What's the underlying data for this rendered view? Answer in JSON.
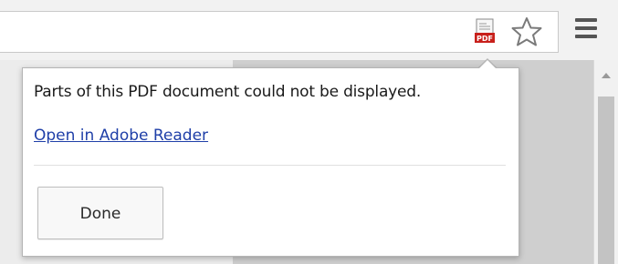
{
  "toolbar": {
    "pdf_badge": "PDF",
    "icons": [
      "pdf-document-icon",
      "bookmark-star-icon",
      "menu-icon"
    ]
  },
  "bubble": {
    "message": "Parts of this PDF document could not be displayed.",
    "link": "Open in Adobe Reader",
    "done_label": "Done"
  },
  "colors": {
    "link": "#1f3fa8",
    "pdf_badge": "#c8201b"
  }
}
